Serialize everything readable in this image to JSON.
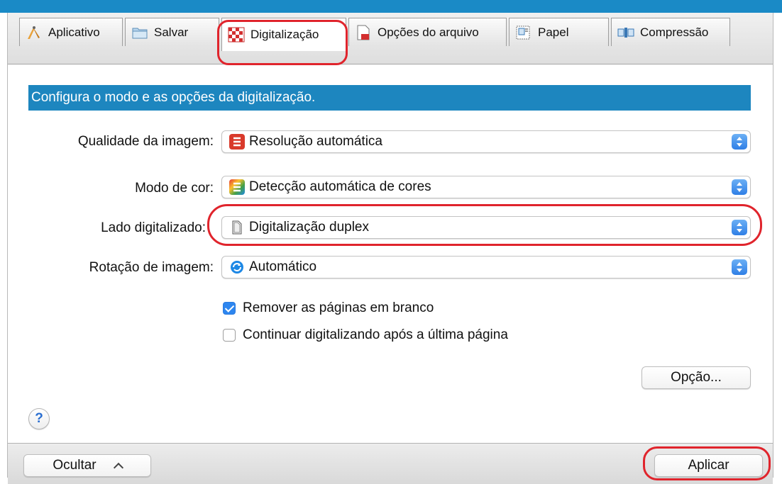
{
  "tabs": [
    {
      "label": "Aplicativo",
      "icon": "pen-compass-icon"
    },
    {
      "label": "Salvar",
      "icon": "folder-icon"
    },
    {
      "label": "Digitalização",
      "icon": "checker-pattern-icon",
      "active": true
    },
    {
      "label": "Opções do arquivo",
      "icon": "document-pdf-icon"
    },
    {
      "label": "Papel",
      "icon": "paper-size-icon"
    },
    {
      "label": "Compressão",
      "icon": "compression-icon"
    }
  ],
  "header": {
    "text": "Configura o modo e as opções da digitalização."
  },
  "fields": [
    {
      "label": "Qualidade da imagem:",
      "value": "Resolução automática",
      "icon": "scansnap-red-icon"
    },
    {
      "label": "Modo de cor:",
      "value": "Detecção automática de cores",
      "icon": "scansnap-color-icon"
    },
    {
      "label": "Lado digitalizado:",
      "value": "Digitalização duplex",
      "icon": "duplex-page-icon"
    },
    {
      "label": "Rotação de imagem:",
      "value": "Automático",
      "icon": "rotation-icon"
    }
  ],
  "checkboxes": [
    {
      "label": "Remover as páginas em branco",
      "checked": true
    },
    {
      "label": "Continuar digitalizando após a última página",
      "checked": false
    }
  ],
  "buttons": {
    "option": "Opção...",
    "hide": "Ocultar",
    "apply": "Aplicar",
    "help": "?"
  },
  "colors": {
    "accent_blue": "#1d86bf",
    "highlight_red": "#e0242c",
    "checkbox_blue": "#2d86ef"
  }
}
